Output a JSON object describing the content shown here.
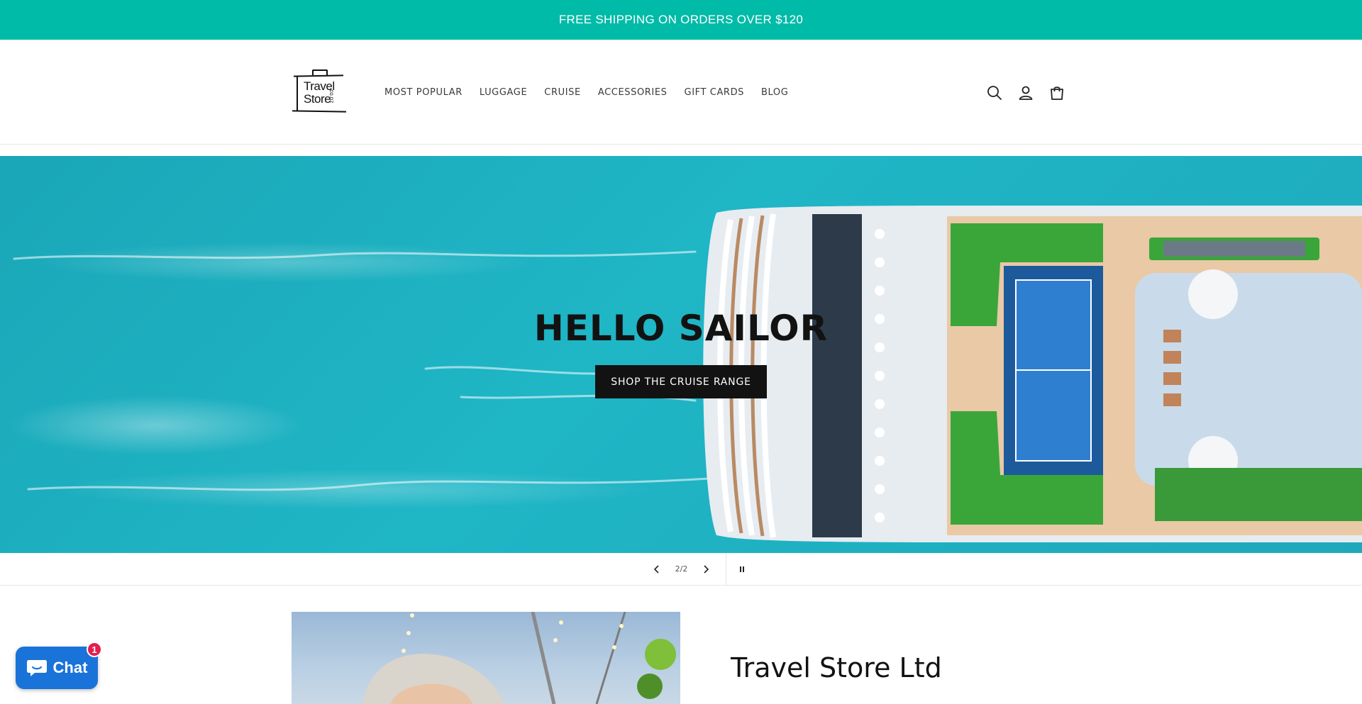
{
  "announcement": {
    "text": "FREE SHIPPING ON ORDERS OVER $120"
  },
  "header": {
    "logo": {
      "line1": "Travel",
      "line2": "Store",
      "suffix": ".co.nz"
    },
    "nav": [
      {
        "label": "MOST POPULAR"
      },
      {
        "label": "LUGGAGE"
      },
      {
        "label": "CRUISE"
      },
      {
        "label": "ACCESSORIES"
      },
      {
        "label": "GIFT CARDS"
      },
      {
        "label": "BLOG"
      }
    ],
    "icons": [
      "search-icon",
      "account-icon",
      "cart-icon"
    ]
  },
  "hero": {
    "title": "HELLO SAILOR",
    "button_label": "SHOP THE CRUISE RANGE"
  },
  "slider": {
    "counter": "2/2"
  },
  "about": {
    "title": "Travel Store Ltd"
  },
  "chat": {
    "label": "Chat",
    "badge": "1"
  },
  "colors": {
    "announcement_bg": "#00bba7",
    "button_bg": "#121212",
    "chat_bg": "#1a73d9",
    "badge_bg": "#e21f4f"
  }
}
